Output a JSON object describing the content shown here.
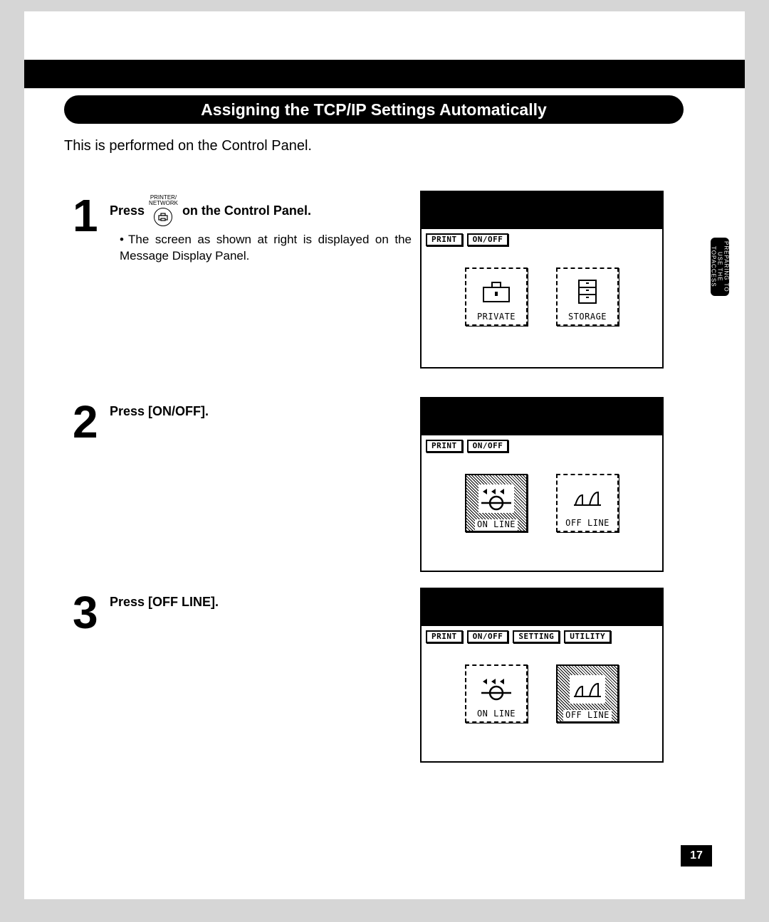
{
  "section_title": "Assigning the TCP/IP Settings Automatically",
  "intro_text": "This is performed on the Control Panel.",
  "side_tab": "PREPARING TO USE THE TOPACCESS",
  "printer_button_label": "PRINTER/\nNETWORK",
  "steps": {
    "s1": {
      "num": "1",
      "press_word": "Press",
      "title_rest": "on the Control Panel.",
      "body": "The screen as shown at right is displayed on the Message Display Panel."
    },
    "s2": {
      "num": "2",
      "title": "Press [ON/OFF]."
    },
    "s3": {
      "num": "3",
      "title": "Press [OFF LINE]."
    }
  },
  "panels": {
    "p1": {
      "tabs": [
        "PRINT",
        "ON/OFF"
      ],
      "icons": [
        {
          "label": "PRIVATE",
          "type": "briefcase"
        },
        {
          "label": "STORAGE",
          "type": "storage"
        }
      ]
    },
    "p2": {
      "tabs": [
        "PRINT",
        "ON/OFF"
      ],
      "icons": [
        {
          "label": "ON LINE",
          "type": "online",
          "shaded": true
        },
        {
          "label": "OFF LINE",
          "type": "offline"
        }
      ]
    },
    "p3": {
      "tabs": [
        "PRINT",
        "ON/OFF",
        "SETTING",
        "UTILITY"
      ],
      "icons": [
        {
          "label": "ON LINE",
          "type": "online"
        },
        {
          "label": "OFF LINE",
          "type": "offline",
          "shaded": true
        }
      ]
    }
  },
  "page_number": "17"
}
